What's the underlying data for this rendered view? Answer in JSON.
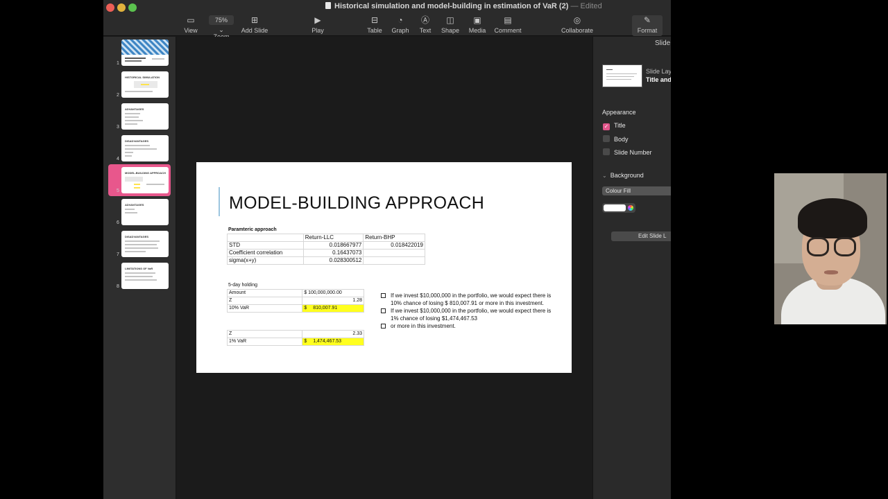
{
  "window": {
    "title": "Historical simulation and model-building in estimation of VaR (2)",
    "edited": "— Edited"
  },
  "toolbar": {
    "view": "View",
    "zoom_value": "75%",
    "zoom": "Zoom",
    "add_slide": "Add Slide",
    "play": "Play",
    "table": "Table",
    "graph": "Graph",
    "text": "Text",
    "shape": "Shape",
    "media": "Media",
    "comment": "Comment",
    "collaborate": "Collaborate",
    "format": "Format"
  },
  "navigator": {
    "slides": [
      {
        "num": "1",
        "title": ""
      },
      {
        "num": "2",
        "title": "HISTORICAL SIMULATION"
      },
      {
        "num": "3",
        "title": "ADVANTAGES"
      },
      {
        "num": "4",
        "title": "DISADVANTAGES"
      },
      {
        "num": "5",
        "title": "MODEL-BUILDING APPROACH"
      },
      {
        "num": "6",
        "title": "ADVANTAGES"
      },
      {
        "num": "7",
        "title": "DISADVANTAGES"
      },
      {
        "num": "8",
        "title": "LIMITATIONS OF VaR"
      }
    ]
  },
  "slide": {
    "title": "MODEL-BUILDING APPROACH",
    "param_caption": "Paramteric approach",
    "param_table": {
      "headers": [
        "",
        "Return-LLC",
        "Return-BHP"
      ],
      "rows": [
        [
          "STD",
          "0.018667977",
          "0.018422019"
        ],
        [
          "Coefficient correlation",
          "0.16437073",
          ""
        ],
        [
          "sigma(x+y)",
          "0.028300512",
          ""
        ]
      ]
    },
    "holding_caption": "5-day holding",
    "var10_table": {
      "amount_label": "Amount",
      "amount_value": "$ 100,000,000.00",
      "z_label": "Z",
      "z_value": "1.28",
      "var_label": "10% VaR",
      "var_currency": "$",
      "var_value": "810,007.91"
    },
    "var1_table": {
      "z_label": "Z",
      "z_value": "2.33",
      "var_label": "1% VaR",
      "var_currency": "$",
      "var_value": "1,474,467.53"
    },
    "bullets": [
      "If we invest $10,000,000 in the portfolio, we would expect there is 10% chance of losing $ 810,007.91  or more in this investment.",
      "If we invest $10,000,000 in the portfolio, we would expect there is 1% chance of losing  $1,474,467.53",
      "or more in this investment."
    ]
  },
  "inspector": {
    "tab": "Slide",
    "layout_caption": "Slide Layout",
    "layout_name": "Title and",
    "appearance": "Appearance",
    "title_label": "Title",
    "title_checked": true,
    "body_label": "Body",
    "body_checked": false,
    "slide_number_label": "Slide Number",
    "slide_number_checked": false,
    "background": "Background",
    "fill_type": "Colour Fill",
    "fill_color": "#ffffff",
    "edit_layout": "Edit Slide L"
  },
  "colors": {
    "accent": "#e8578c",
    "highlight": "#ffff1f"
  }
}
